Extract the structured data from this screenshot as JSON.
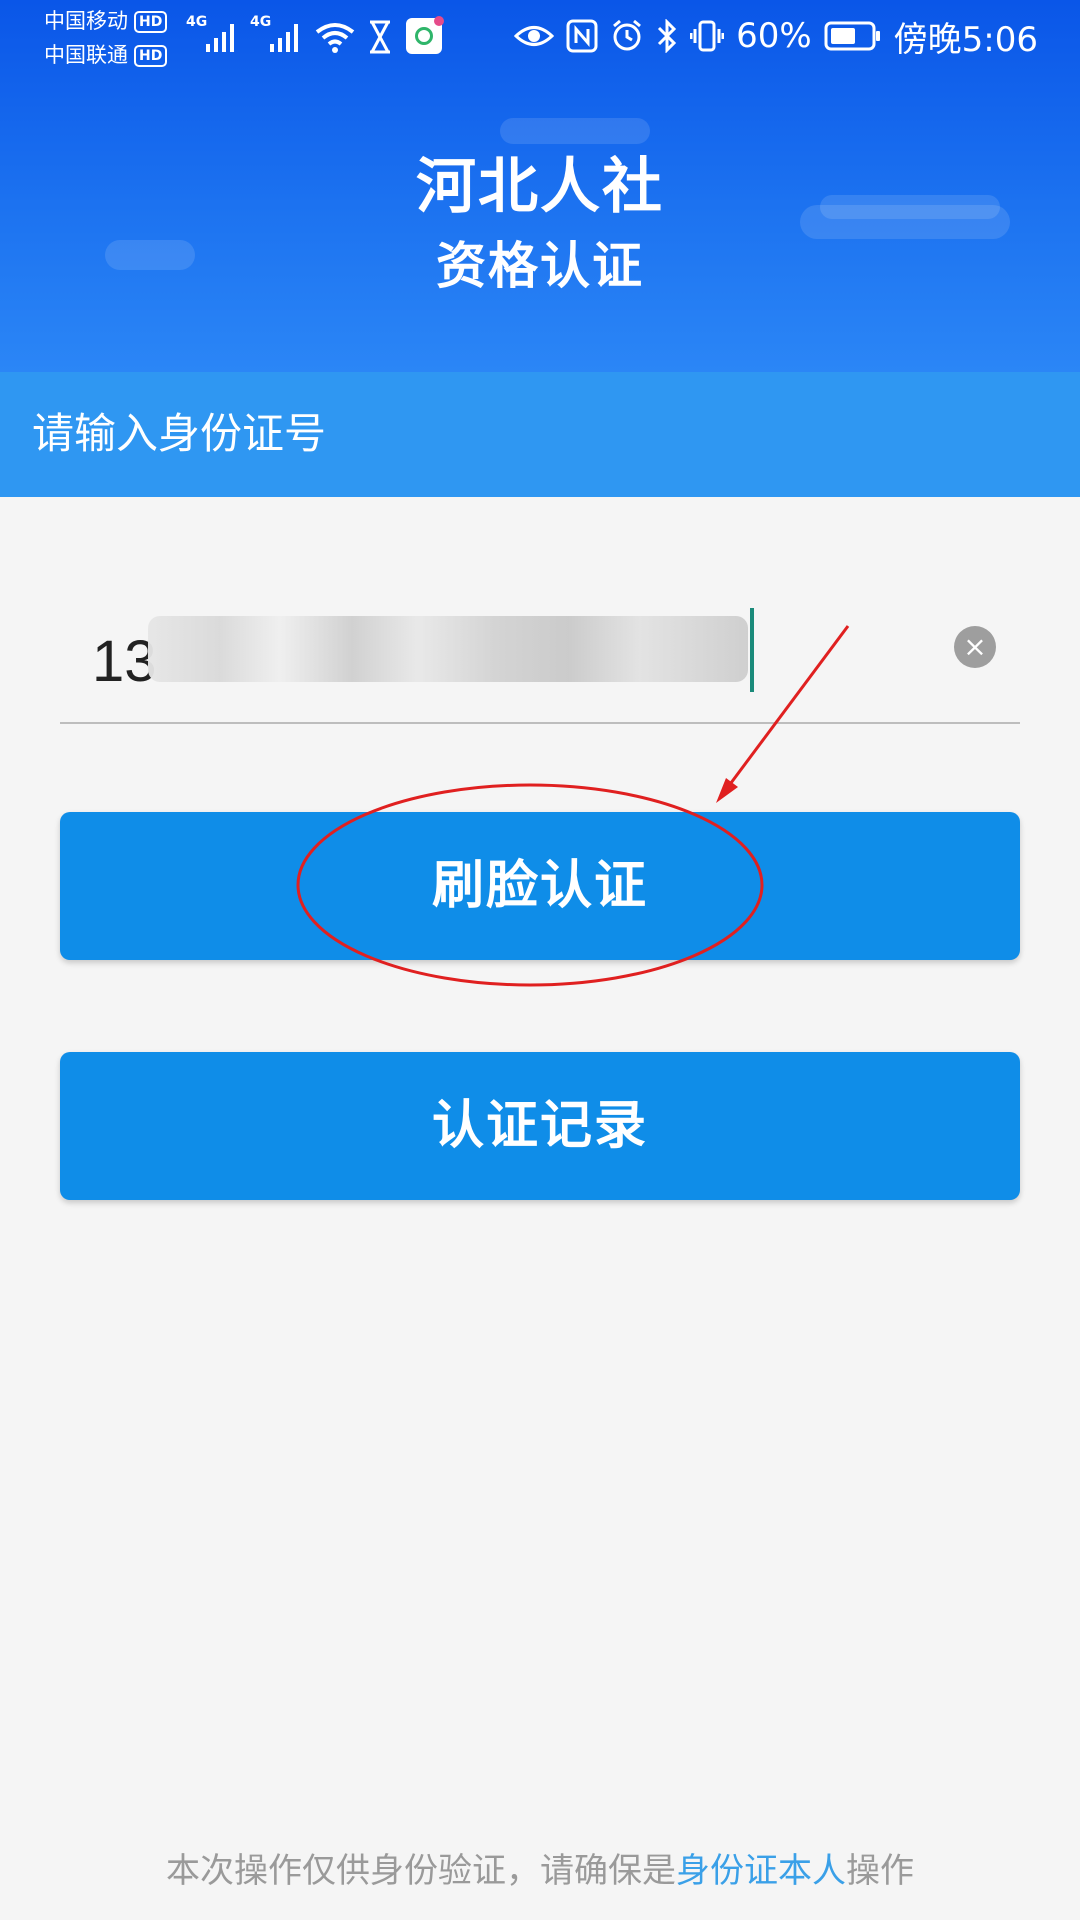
{
  "status_bar": {
    "carrier_1": "中国移动",
    "carrier_2": "中国联通",
    "hd_badge": "HD",
    "network_1": "4G",
    "network_2": "4G",
    "battery_percent": "60%",
    "time": "傍晚5:06",
    "icons": [
      "signal-icon",
      "wifi-icon",
      "hourglass-icon",
      "app-notification-icon",
      "eye-icon",
      "nfc-icon",
      "alarm-icon",
      "bluetooth-icon",
      "vibrate-icon",
      "battery-icon"
    ]
  },
  "header": {
    "title": "河北人社",
    "subtitle": "资格认证"
  },
  "prompt": {
    "label": "请输入身份证号"
  },
  "id_input": {
    "visible_value": "13",
    "clear_symbol": "×"
  },
  "buttons": {
    "face_auth": "刷脸认证",
    "records": "认证记录"
  },
  "footer": {
    "text_before": "本次操作仅供身份验证，请确保是",
    "highlight": "身份证本人",
    "text_after": "操作"
  },
  "colors": {
    "header_blue": "#0a56e8",
    "prompt_bar": "#2f97f2",
    "button_blue": "#0f8de8",
    "annotation_red": "#e02020",
    "footer_highlight": "#3aa0e8"
  }
}
